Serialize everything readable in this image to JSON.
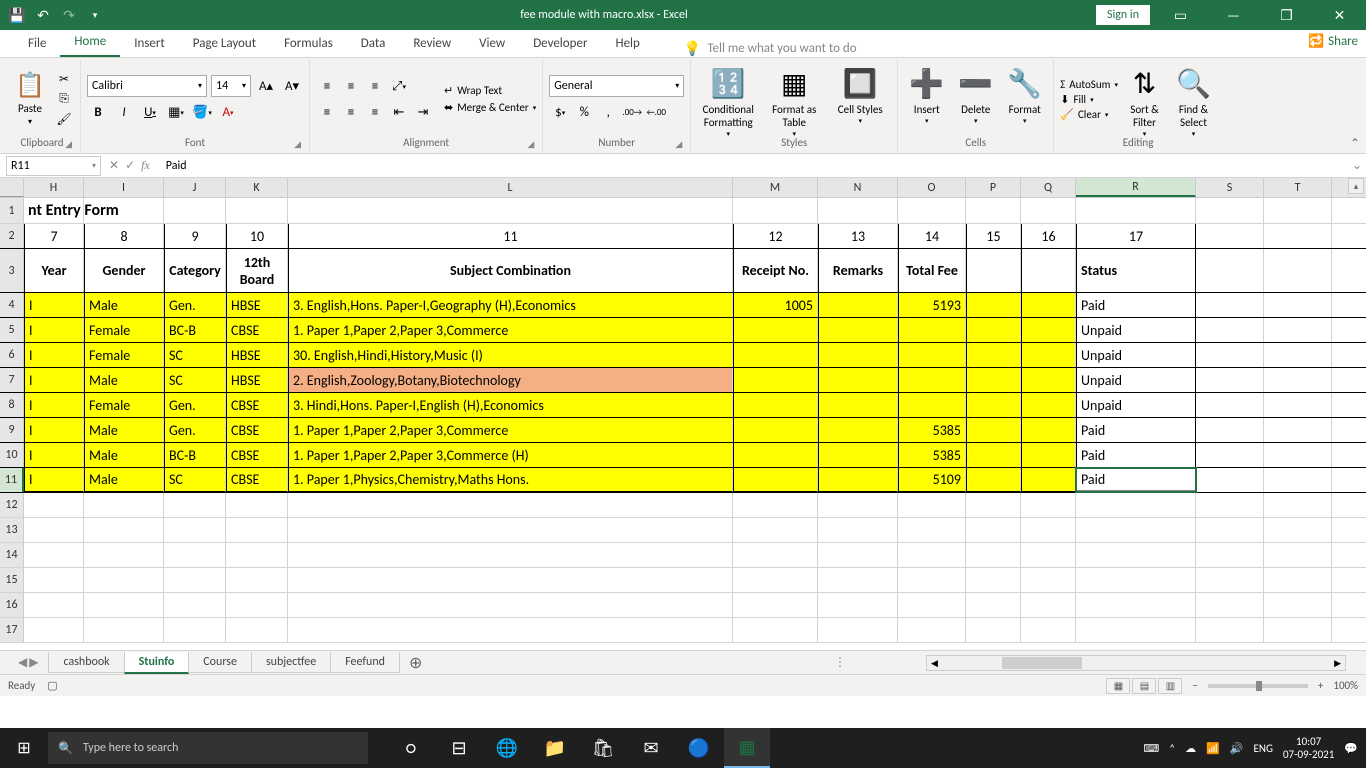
{
  "title": "fee module with macro.xlsx - Excel",
  "signin": "Sign in",
  "share": "Share",
  "tabs": [
    "File",
    "Home",
    "Insert",
    "Page Layout",
    "Formulas",
    "Data",
    "Review",
    "View",
    "Developer",
    "Help"
  ],
  "active_tab": "Home",
  "tellme": "Tell me what you want to do",
  "ribbon": {
    "clipboard": {
      "label": "Clipboard",
      "paste": "Paste"
    },
    "font": {
      "label": "Font",
      "name": "Calibri",
      "size": "14"
    },
    "alignment": {
      "label": "Alignment",
      "wrap": "Wrap Text",
      "merge": "Merge & Center"
    },
    "number": {
      "label": "Number",
      "format": "General"
    },
    "styles": {
      "label": "Styles",
      "cond": "Conditional Formatting",
      "table": "Format as Table",
      "cell": "Cell Styles"
    },
    "cells": {
      "label": "Cells",
      "insert": "Insert",
      "delete": "Delete",
      "format": "Format"
    },
    "editing": {
      "label": "Editing",
      "autosum": "AutoSum",
      "fill": "Fill",
      "clear": "Clear",
      "sort": "Sort & Filter",
      "find": "Find & Select"
    }
  },
  "name_box": "R11",
  "formula_value": "Paid",
  "columns": [
    "H",
    "I",
    "J",
    "K",
    "L",
    "M",
    "N",
    "O",
    "P",
    "Q",
    "R",
    "S",
    "T"
  ],
  "active_col": "R",
  "active_row": "11",
  "row1": {
    "H": "nt Entry Form"
  },
  "row2": {
    "H": "7",
    "I": "8",
    "J": "9",
    "K": "10",
    "L": "11",
    "M": "12",
    "N": "13",
    "O": "14",
    "P": "15",
    "Q": "16",
    "R": "17"
  },
  "row3": {
    "H": "Year",
    "I": "Gender",
    "J": "Category",
    "K": "12th Board",
    "L": "Subject Combination",
    "M": "Receipt No.",
    "N": "Remarks",
    "O": "Total Fee",
    "R": "Status"
  },
  "data_rows": [
    {
      "H": "I",
      "I": "Male",
      "J": "Gen.",
      "K": "HBSE",
      "L": "3. English,Hons. Paper-I,Geography (H),Economics",
      "M": "1005",
      "O": "5193",
      "R": "Paid",
      "L_bg": "yellow"
    },
    {
      "H": "I",
      "I": "Female",
      "J": "BC-B",
      "K": "CBSE",
      "L": "1. Paper 1,Paper 2,Paper 3,Commerce",
      "M": "",
      "O": "",
      "R": "Unpaid",
      "L_bg": "yellow"
    },
    {
      "H": "I",
      "I": "Female",
      "J": "SC",
      "K": "HBSE",
      "L": "30. English,Hindi,History,Music (I)",
      "M": "",
      "O": "",
      "R": "Unpaid",
      "L_bg": "yellow"
    },
    {
      "H": "I",
      "I": "Male",
      "J": "SC",
      "K": "HBSE",
      "L": "2. English,Zoology,Botany,Biotechnology",
      "M": "",
      "O": "",
      "R": "Unpaid",
      "L_bg": "peach"
    },
    {
      "H": "I",
      "I": "Female",
      "J": "Gen.",
      "K": "CBSE",
      "L": "3. Hindi,Hons. Paper-I,English (H),Economics",
      "M": "",
      "O": "",
      "R": "Unpaid",
      "L_bg": "yellow"
    },
    {
      "H": "I",
      "I": "Male",
      "J": "Gen.",
      "K": "CBSE",
      "L": "1. Paper 1,Paper 2,Paper 3,Commerce",
      "M": "",
      "O": "5385",
      "R": "Paid",
      "L_bg": "yellow"
    },
    {
      "H": "I",
      "I": "Male",
      "J": "BC-B",
      "K": "CBSE",
      "L": "1. Paper 1,Paper 2,Paper 3,Commerce (H)",
      "M": "",
      "O": "5385",
      "R": "Paid",
      "L_bg": "yellow"
    },
    {
      "H": "I",
      "I": "Male",
      "J": "SC",
      "K": "CBSE",
      "L": "1. Paper 1,Physics,Chemistry,Maths Hons.",
      "M": "",
      "O": "5109",
      "R": "Paid",
      "L_bg": "yellow"
    }
  ],
  "dropdown": {
    "options": [
      "Unpaid",
      "Paid"
    ],
    "selected": "Paid"
  },
  "sheet_tabs": [
    "cashbook",
    "Stuinfo",
    "Course",
    "subjectfee",
    "Feefund"
  ],
  "active_sheet": "Stuinfo",
  "status": "Ready",
  "zoom": "100%",
  "taskbar": {
    "search": "Type here to search",
    "lang": "ENG",
    "time": "10:07",
    "date": "07-09-2021"
  }
}
